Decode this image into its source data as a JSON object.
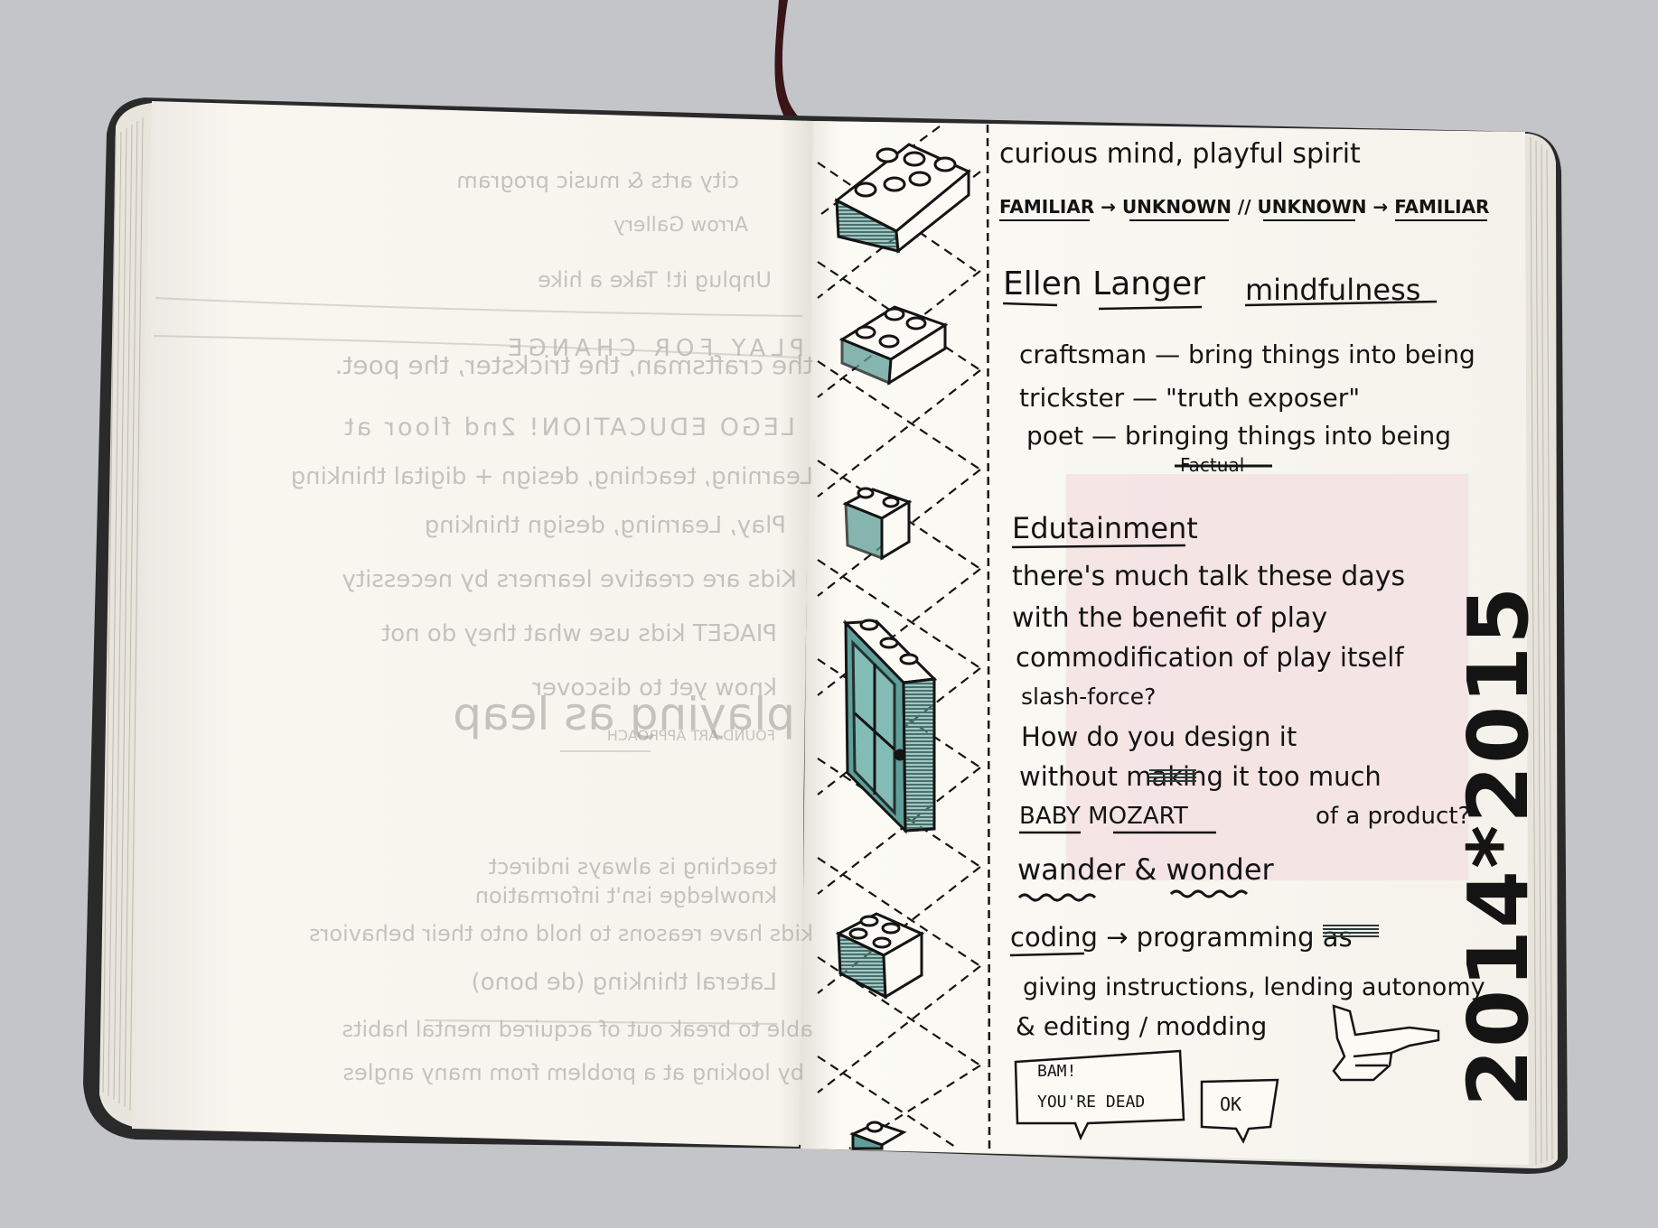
{
  "right_page": {
    "line_1": "curious mind, playful spirit",
    "line_2": "FAMILIAR → UNKNOWN // UNKNOWN → FAMILIAR",
    "heading_1": "Ellen Langer",
    "heading_1_tail": "mindfulness",
    "list": [
      "craftsman — bring things into being",
      "trickster — \"truth exposer\"",
      "poet — bringing things into being"
    ],
    "struck_word": "Factual",
    "heading_2": "Edutainment",
    "para_1": [
      "there's much talk these days",
      "with the benefit of play",
      "commodification of play itself",
      "slash-force?",
      "How do you design it",
      "without making it too much",
      "BABY MOZART",
      "of a product?"
    ],
    "wander": "wander & wonder",
    "coding": [
      "coding → programming as",
      "giving instructions, lending autonomy",
      "& editing / modding"
    ],
    "bubble_1_line_1": "BAM!",
    "bubble_1_line_2": "YOU'RE DEAD",
    "bubble_2": "OK",
    "year_stamp": "2014*2015"
  },
  "left_page_bleed": {
    "lines": [
      "the craftsman, the trickster, the poet.",
      "LEGO EDUCATION! 2nd floor at",
      "Learning, teaching, design + digital thinking",
      "Play, Learning, design thinking",
      "Kids are creative learners by necessity",
      "PIAGET kids use what they do not",
      "know yet to discover",
      "playing as leap",
      "FOUND ART APPROACH",
      "teaching is always indirect",
      "knowledge isn't information",
      "kids have reasons to hold onto their behaviors",
      "Lateral thinking (de bono)",
      "able to break out of acquired mental habits",
      "by looking at a problem from many angles"
    ],
    "top_faint": [
      "city arts & music program",
      "Arrow Gallery",
      "Unplug it! Take a hike",
      "PLAY FOR CHANGE"
    ]
  },
  "colors": {
    "background": "#c4c5c9",
    "paper": "#f8f6ef",
    "ink": "#141414",
    "teal_ink": "#4f9a93",
    "bleed": "#9a9a96",
    "pink_bleed": "#f3dde0"
  }
}
